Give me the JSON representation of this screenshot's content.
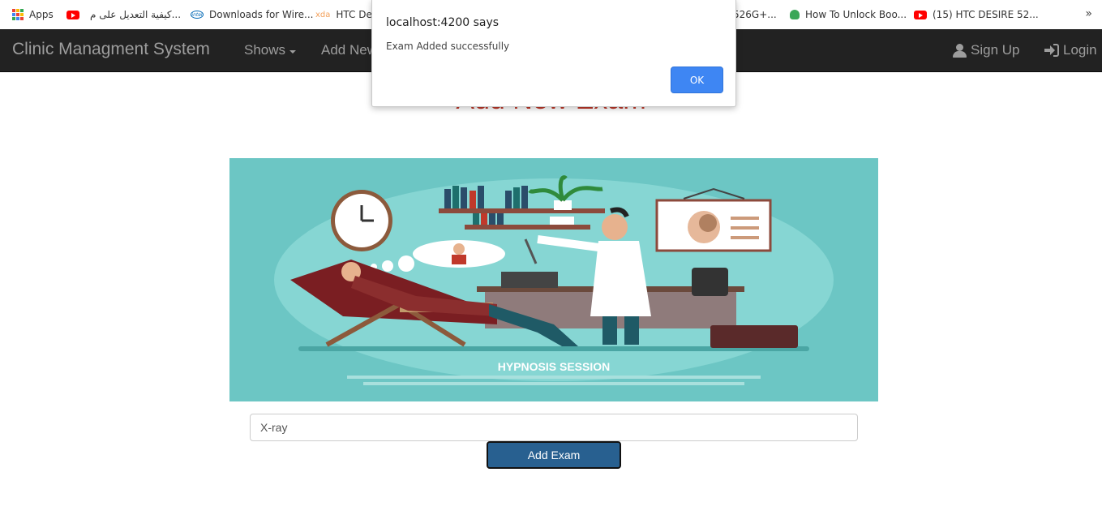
{
  "bookmarks": {
    "items": [
      {
        "label": "Apps",
        "icon": "apps-grid-icon"
      },
      {
        "label": "كيفية التعديل على م...",
        "icon": "youtube-icon"
      },
      {
        "label": "Downloads for Wire...",
        "icon": "intel-icon"
      },
      {
        "label": "HTC Des",
        "icon": "xda-icon"
      },
      {
        "label": "526G+...",
        "icon": ""
      },
      {
        "label": "How To Unlock Boo...",
        "icon": "android-icon"
      },
      {
        "label": "(15) HTC DESIRE 52...",
        "icon": "youtube-icon"
      }
    ],
    "more": "»"
  },
  "navbar": {
    "brand": "Clinic Managment System",
    "shows_label": "Shows",
    "add_new_label": "Add New",
    "signup_label": "Sign Up",
    "login_label": "Login"
  },
  "page": {
    "title": "Add New Exam",
    "illustration_caption": "HYPNOSIS SESSION"
  },
  "form": {
    "exam_value": "X-ray",
    "submit_label": "Add Exam"
  },
  "dialog": {
    "title": "localhost:4200 says",
    "message": "Exam Added successfully",
    "ok_label": "OK"
  },
  "colors": {
    "navbar_bg": "#222222",
    "title_red": "#c0392b",
    "button_blue": "#286090",
    "ok_blue": "#3e86f3",
    "illustration_teal": "#6cc6c4"
  }
}
